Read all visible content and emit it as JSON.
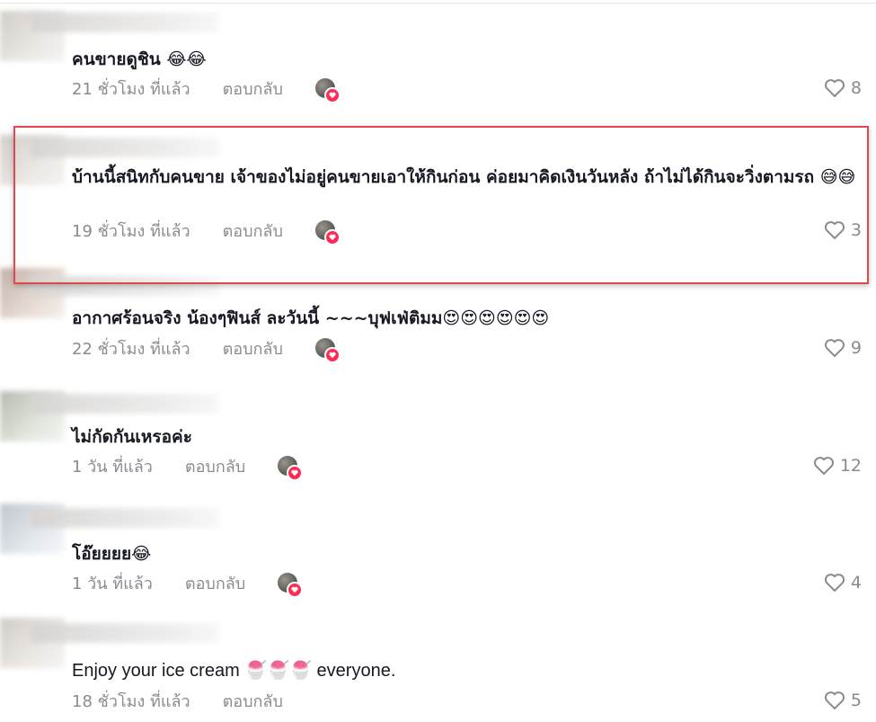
{
  "comments": [
    {
      "text": "คนขายดูชิน 😂😂",
      "time": "21 ชั่วโมง ที่แล้ว",
      "reply": "ตอบกลับ",
      "likes": "8"
    },
    {
      "text": "บ้านนี้สนิทกับคนขาย เจ้าของไม่อยู่คนขายเอาให้กินก่อน ค่อยมาคิดเงินวันหลัง ถ้าไม่ได้กินจะวิ่งตามรถ 😅😅",
      "time": "19 ชั่วโมง ที่แล้ว",
      "reply": "ตอบกลับ",
      "likes": "3"
    },
    {
      "text": "อากาศร้อนจริง น้องๆฟินส์ ละวันนี้ ~~~บุฟเฟ่ติมม😍😍😍😍😍😍",
      "time": "22 ชั่วโมง ที่แล้ว",
      "reply": "ตอบกลับ",
      "likes": "9"
    },
    {
      "text": "ไม่กัดกันเหรอค่ะ",
      "time": "1 วัน ที่แล้ว",
      "reply": "ตอบกลับ",
      "likes": "12"
    },
    {
      "text": "โอ๊ยยยย😂",
      "time": "1 วัน ที่แล้ว",
      "reply": "ตอบกลับ",
      "likes": "4"
    },
    {
      "text": "Enjoy your ice cream 🍧🍧🍧 everyone.",
      "time": "18 ชั่วโมง ที่แล้ว",
      "reply": "ตอบกลับ",
      "likes": "5"
    }
  ],
  "colors": {
    "text": "#161823",
    "meta": "#8a8b91",
    "highlight": "#e0484c",
    "badge": "#fe2c55"
  },
  "icons": {
    "like": "heart-outline-icon",
    "creator_badge": "heart-icon"
  }
}
